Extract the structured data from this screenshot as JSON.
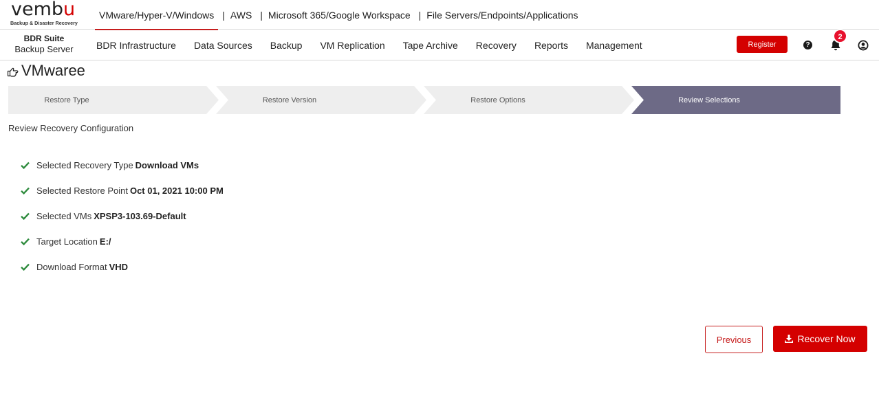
{
  "brand": {
    "logo_text_main": "vemb",
    "logo_text_accent": "u",
    "tagline": "Backup & Disaster Recovery"
  },
  "product_tabs": [
    {
      "label": "VMware/Hyper-V/Windows",
      "active": true
    },
    {
      "label": "AWS",
      "active": false
    },
    {
      "label": "Microsoft 365/Google Workspace",
      "active": false
    },
    {
      "label": "File Servers/Endpoints/Applications",
      "active": false
    }
  ],
  "separator": "|",
  "suite": {
    "title": "BDR Suite",
    "subtitle": "Backup Server"
  },
  "nav": {
    "items": [
      "BDR Infrastructure",
      "Data Sources",
      "Backup",
      "VM Replication",
      "Tape Archive",
      "Recovery",
      "Reports",
      "Management"
    ],
    "register_label": "Register",
    "help_glyph": "?",
    "notification_count": "2"
  },
  "page": {
    "title": "VMwaree"
  },
  "wizard": {
    "steps": [
      {
        "label": "Restore Type",
        "active": false
      },
      {
        "label": "Restore Version",
        "active": false
      },
      {
        "label": "Restore Options",
        "active": false
      },
      {
        "label": "Review Selections",
        "active": true
      }
    ],
    "colors": {
      "inactive": "#eeeeee",
      "active": "#6d6a86"
    }
  },
  "review": {
    "section_title": "Review Recovery Configuration",
    "items": [
      {
        "label": "Selected Recovery Type",
        "value": "Download VMs"
      },
      {
        "label": "Selected Restore Point",
        "value": "Oct 01, 2021 10:00 PM"
      },
      {
        "label": "Selected VMs",
        "value": "XPSP3-103.69-Default"
      },
      {
        "label": "Target Location",
        "value": "E:/"
      },
      {
        "label": "Download Format",
        "value": "VHD"
      }
    ]
  },
  "actions": {
    "previous_label": "Previous",
    "recover_label": "Recover Now"
  },
  "colors": {
    "brand_red": "#d40000",
    "check_green": "#2e8b3d"
  }
}
